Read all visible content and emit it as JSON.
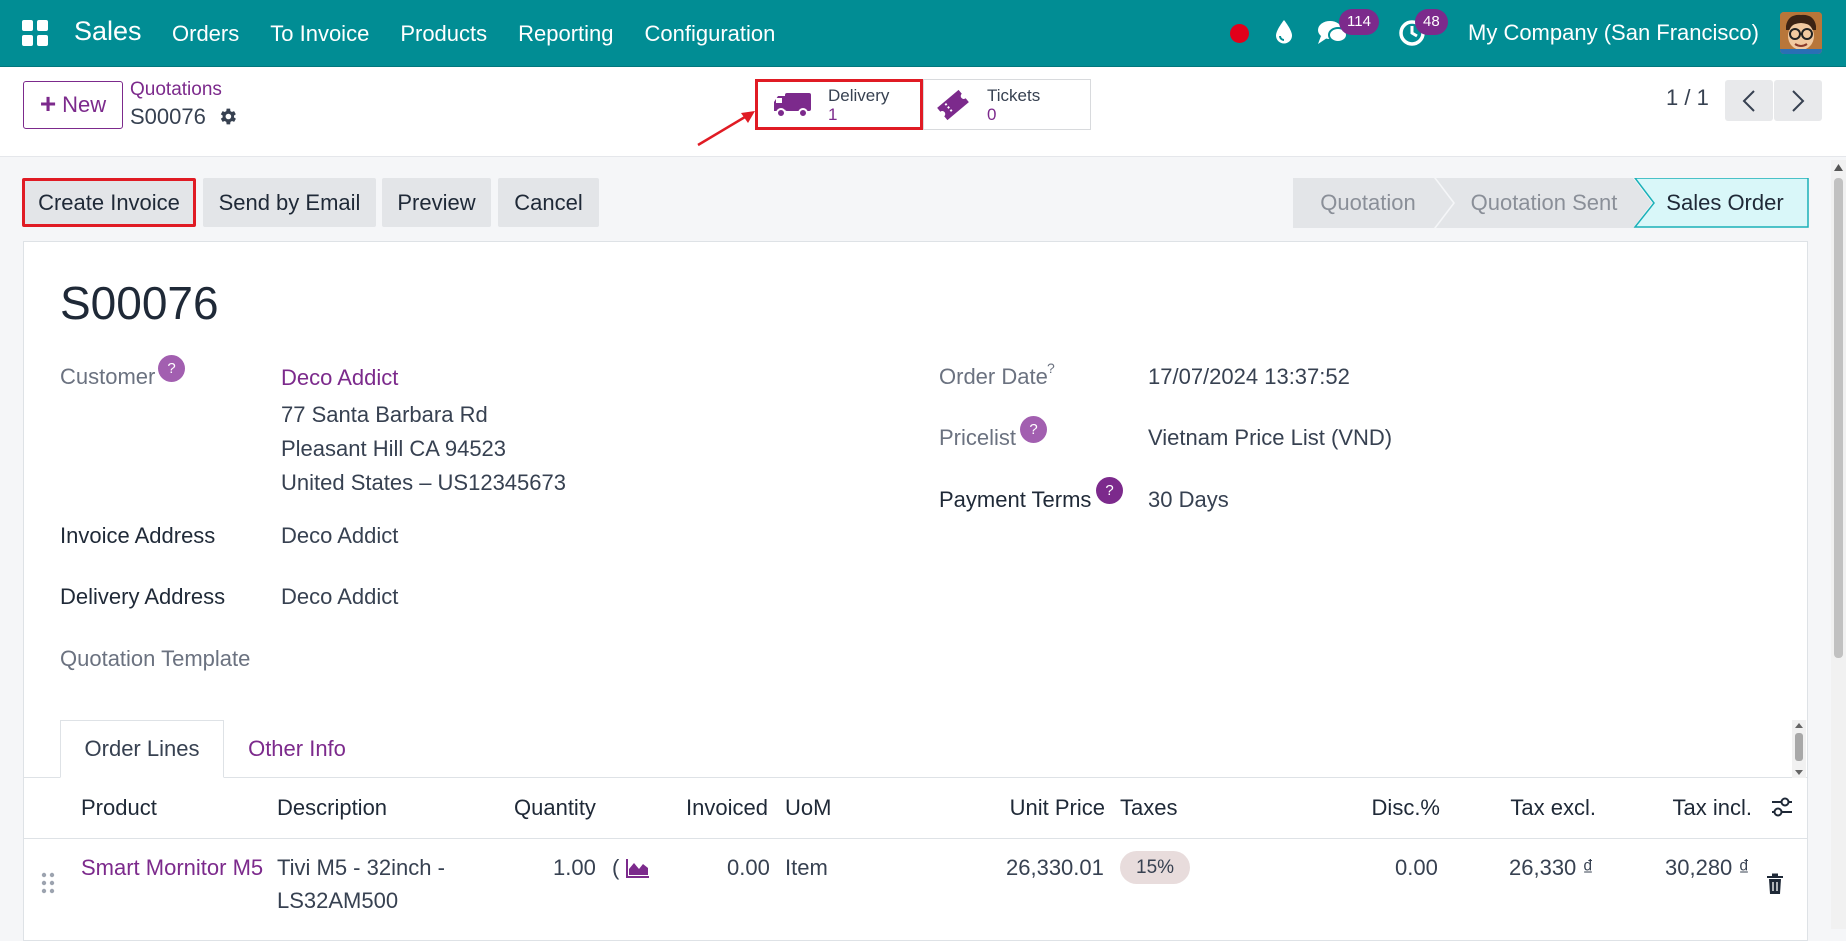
{
  "navbar": {
    "brand": "Sales",
    "menu": [
      "Orders",
      "To Invoice",
      "Products",
      "Reporting",
      "Configuration"
    ],
    "chat_count": "114",
    "activity_count": "48",
    "company": "My Company (San Francisco)"
  },
  "control_panel": {
    "new_label": "New",
    "breadcrumb_parent": "Quotations",
    "record_name": "S00076",
    "smart_buttons": {
      "delivery": {
        "label": "Delivery",
        "value": "1"
      },
      "tickets": {
        "label": "Tickets",
        "value": "0"
      }
    },
    "pager": "1 / 1"
  },
  "status_bar": {
    "actions": [
      "Create Invoice",
      "Send by Email",
      "Preview",
      "Cancel"
    ],
    "stages": [
      "Quotation",
      "Quotation Sent",
      "Sales Order"
    ],
    "active_stage": "Sales Order"
  },
  "form": {
    "title": "S00076",
    "customer_label": "Customer",
    "customer_name": "Deco Addict",
    "customer_address": [
      "77 Santa Barbara Rd",
      "Pleasant Hill CA 94523",
      "United States – US12345673"
    ],
    "invoice_address_label": "Invoice Address",
    "invoice_address": "Deco Addict",
    "delivery_address_label": "Delivery Address",
    "delivery_address": "Deco Addict",
    "quotation_template_label": "Quotation Template",
    "order_date_label": "Order Date",
    "order_date": "17/07/2024 13:37:52",
    "pricelist_label": "Pricelist",
    "pricelist": "Vietnam Price List (VND)",
    "payment_terms_label": "Payment Terms",
    "payment_terms": "30 Days",
    "help_mark": "?"
  },
  "tabs": [
    "Order Lines",
    "Other Info"
  ],
  "order_lines": {
    "columns": [
      "Product",
      "Description",
      "Quantity",
      "Invoiced",
      "UoM",
      "Unit Price",
      "Taxes",
      "Disc.%",
      "Tax excl.",
      "Tax incl."
    ],
    "rows": [
      {
        "product": "Smart Mornitor M5",
        "description_1": "Tivi M5 - 32inch -",
        "description_2": "LS32AM500",
        "quantity": "1.00",
        "invoiced": "0.00",
        "uom": "Item",
        "unit_price": "26,330.01",
        "taxes": "15%",
        "discount": "0.00",
        "tax_excl": "26,330 ₫",
        "tax_incl": "30,280 ₫"
      }
    ]
  },
  "colors": {
    "navbar": "#018d94",
    "accent": "#7c2a8c",
    "highlight_box": "#e01b24",
    "active_stage": "#d9f7f9"
  }
}
